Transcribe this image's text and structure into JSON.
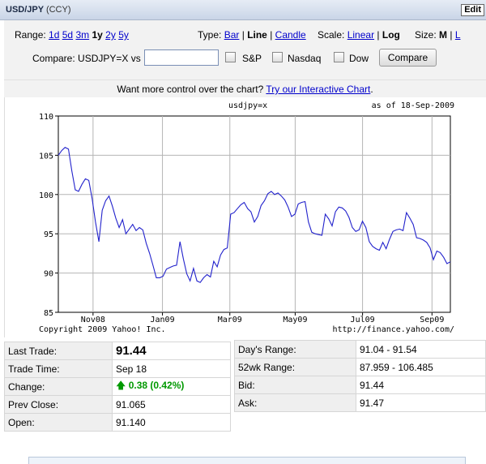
{
  "header": {
    "symbol": "USD/JPY",
    "ccy": "(CCY)",
    "edit_label": "Edit"
  },
  "range": {
    "label": "Range:",
    "options": [
      "1d",
      "5d",
      "3m",
      "1y",
      "2y",
      "5y"
    ],
    "selected": "1y"
  },
  "type": {
    "label": "Type:",
    "bar": "Bar",
    "line": "Line",
    "candle": "Candle",
    "selected": "Line"
  },
  "scale": {
    "label": "Scale:",
    "linear": "Linear",
    "log": "Log",
    "selected": "Log"
  },
  "size": {
    "label": "Size:",
    "m": "M",
    "l": "L",
    "selected": "M"
  },
  "compare": {
    "label": "Compare: USDJPY=X vs",
    "input_value": "",
    "sp": "S&P",
    "nasdaq": "Nasdaq",
    "dow": "Dow",
    "button": "Compare"
  },
  "promo": {
    "text": "Want more control over the chart? ",
    "link": "Try our Interactive Chart",
    "end": "."
  },
  "chart_data": {
    "type": "line",
    "title": "usdjpy=x",
    "as_of": "as of 18-Sep-2009",
    "copyright": "Copyright 2009 Yahoo! Inc.",
    "source": "http://finance.yahoo.com/",
    "ylim": [
      85,
      110
    ],
    "yticks": [
      85,
      90,
      95,
      100,
      105,
      110
    ],
    "xticks": [
      "Nov08",
      "Jan09",
      "Mar09",
      "May09",
      "Jul09",
      "Sep09"
    ],
    "xtick_index": [
      8.5,
      25.5,
      42,
      58,
      74.5,
      91.5
    ],
    "x_count": 97,
    "grid": true,
    "series": [
      {
        "color": "#2222cc",
        "values": [
          105,
          105.6,
          106,
          105.8,
          103,
          100.6,
          100.4,
          101.3,
          102,
          101.8,
          99.5,
          96.5,
          94,
          98,
          99.2,
          99.8,
          98.5,
          97,
          95.8,
          96.8,
          95,
          95.6,
          96.2,
          95.4,
          95.8,
          95.5,
          93.8,
          92.5,
          91,
          89.4,
          89.4,
          89.6,
          90.5,
          90.7,
          90.9,
          91,
          94,
          91.8,
          89.9,
          89,
          90.6,
          89,
          88.8,
          89.4,
          89.8,
          89.5,
          91.5,
          90.8,
          92.3,
          93,
          93.2,
          97.5,
          97.7,
          98.2,
          98.7,
          99,
          98.2,
          97.8,
          96.5,
          97.2,
          98.6,
          99.2,
          100.1,
          100.4,
          100,
          100.2,
          99.8,
          99.3,
          98.4,
          97.2,
          97.5,
          98.8,
          99,
          99.1,
          96.5,
          95.2,
          95,
          94.9,
          94.8,
          97.5,
          96.9,
          96,
          97.8,
          98.4,
          98.3,
          97.9,
          97.1,
          95.8,
          95.3,
          95.5,
          96.6,
          95.8,
          94,
          93.4,
          93.1,
          92.9,
          93.9,
          93.1,
          94.3,
          95.3,
          95.5,
          95.6,
          95.4,
          97.7,
          97,
          96.2,
          94.5,
          94.4,
          94.2,
          93.9,
          93.2,
          91.7,
          92.8,
          92.6,
          92,
          91.2,
          91.44
        ]
      }
    ]
  },
  "quotes_left": [
    {
      "label": "Last Trade:",
      "value": "91.44"
    },
    {
      "label": "Trade Time:",
      "value": "Sep 18"
    },
    {
      "label": "Change:",
      "value": "0.38 (0.42%)"
    },
    {
      "label": "Prev Close:",
      "value": "91.065"
    },
    {
      "label": "Open:",
      "value": "91.140"
    }
  ],
  "quotes_right": [
    {
      "label": "Day's Range:",
      "value": "91.04 - 91.54"
    },
    {
      "label": "52wk Range:",
      "value": "87.959 - 106.485"
    },
    {
      "label": "Bid:",
      "value": "91.44"
    },
    {
      "label": "Ask:",
      "value": "91.47"
    }
  ],
  "colors": {
    "positive": "#009900",
    "link": "#0000cc",
    "line": "#2222cc"
  }
}
